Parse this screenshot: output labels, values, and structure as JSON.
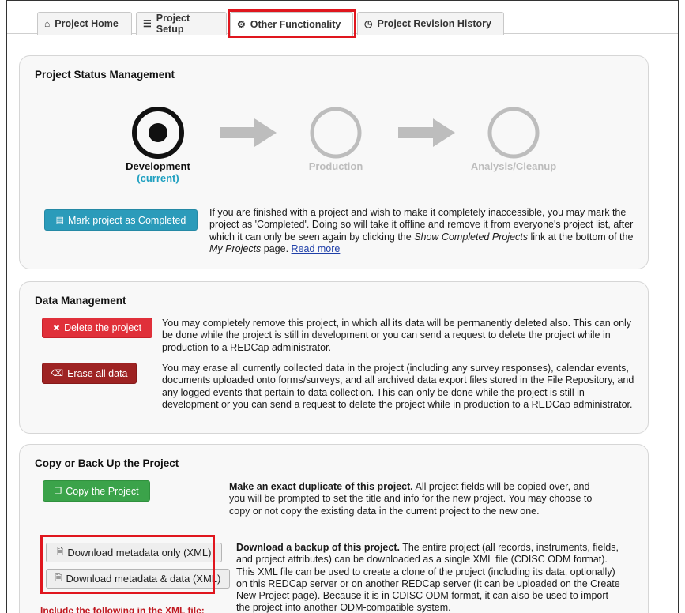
{
  "tabs": [
    {
      "label": "Project Home",
      "icon": "home-icon"
    },
    {
      "label": "Project Setup",
      "icon": "checklist-icon"
    },
    {
      "label": "Other Functionality",
      "icon": "gear-icon"
    },
    {
      "label": "Project Revision History",
      "icon": "history-icon"
    }
  ],
  "status_panel": {
    "title": "Project Status Management",
    "steps": [
      {
        "label": "Development",
        "sublabel": "(current)",
        "state": "current"
      },
      {
        "label": "Production",
        "state": "inactive"
      },
      {
        "label": "Analysis/Cleanup",
        "state": "inactive"
      }
    ],
    "complete_button": "Mark project as Completed",
    "complete_text_1": "If you are finished with a project and wish to make it completely inaccessible, you may mark the project as 'Completed'. Doing so will take it offline and remove it from everyone's project list, after which it can only be seen again by clicking the ",
    "complete_text_em1": "Show Completed Projects",
    "complete_text_2": " link at the bottom of the ",
    "complete_text_em2": "My Projects",
    "complete_text_3": " page. ",
    "read_more": "Read more"
  },
  "data_panel": {
    "title": "Data Management",
    "delete_button": "Delete the project",
    "delete_text": "You may completely remove this project, in which all its data will be permanently deleted also. This can only be done while the project is still in development or you can send a request to delete the project while in production to a REDCap administrator.",
    "erase_button": "Erase all data",
    "erase_text": "You may erase all currently collected data in the project (including any survey responses), calendar events, documents uploaded onto forms/surveys, and all archived data export files stored in the File Repository, and any logged events that pertain to data collection. This can only be done while the project is still in development or you can send a request to delete the project while in production to a REDCap administrator."
  },
  "copy_panel": {
    "title": "Copy or Back Up the Project",
    "copy_button": "Copy the Project",
    "copy_bold": "Make an exact duplicate of this project.",
    "copy_text": " All project fields will be copied over, and you will be prompted to set the title and info for the new project. You may choose to copy or not copy the existing data in the current project to the new one.",
    "download_meta_button": "Download metadata only (XML)",
    "download_data_button": "Download metadata & data (XML)",
    "backup_bold": "Download a backup of this project.",
    "backup_text": " The entire project (all records, instruments, fields, and project attributes) can be downloaded as a single XML file (CDISC ODM format). This XML file can be used to create a clone of the project (including its data, optionally) on this REDCap server or on another REDCap server (it can be uploaded on the Create New Project page). Because it is in CDISC ODM format, it can also be used to import the project into another ODM-compatible system.",
    "include_note": "Include the following in the XML file:"
  },
  "colors": {
    "highlight": "#e0161e",
    "teal": "#2b9bba",
    "current": "#1fa0c0",
    "inactive": "#bdbdbd"
  }
}
